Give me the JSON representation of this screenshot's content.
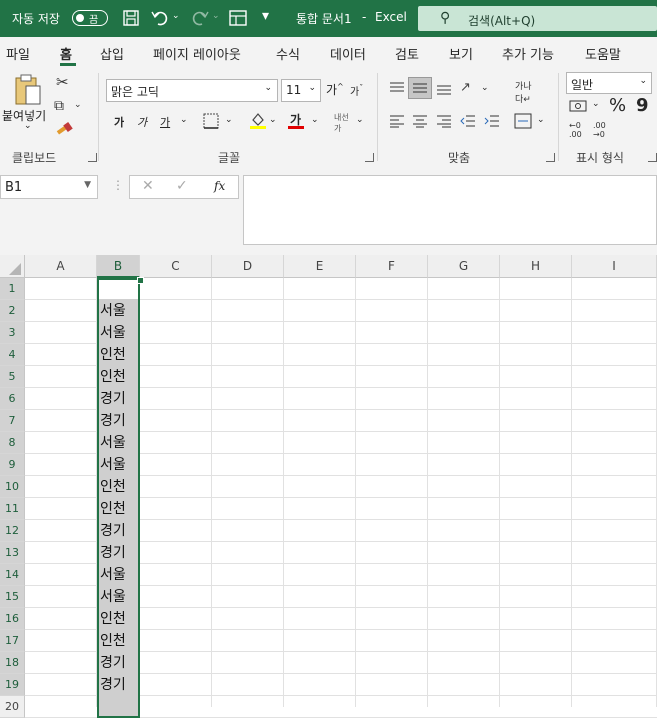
{
  "titlebar": {
    "autosave_label": "자동 저장",
    "autosave_state": "끔",
    "doc_title": "통합 문서1",
    "app_sep": "-",
    "app_name": "Excel",
    "search_placeholder": "검색(Alt+Q)",
    "accent_color": "#217346"
  },
  "tabs": [
    "파일",
    "홈",
    "삽입",
    "페이지 레이아웃",
    "수식",
    "데이터",
    "검토",
    "보기",
    "추가 기능",
    "도움말"
  ],
  "active_tab": "홈",
  "ribbon": {
    "clipboard": {
      "paste_label": "붙여넣기",
      "group_label": "클립보드"
    },
    "font": {
      "font_name": "맑은 고딕",
      "font_size": "11",
      "bold": "가",
      "italic": "가",
      "underline": "가",
      "group_label": "글꼴",
      "font_color": "#e00000",
      "fill_color": "#ffff00"
    },
    "alignment": {
      "group_label": "맞춤"
    },
    "number": {
      "format": "일반",
      "percent": "%",
      "comma": "9",
      "group_label": "표시 형식"
    }
  },
  "formula_bar": {
    "name_box": "B1",
    "fx_label": "fx",
    "formula": ""
  },
  "grid": {
    "columns": [
      "A",
      "B",
      "C",
      "D",
      "E",
      "F",
      "G",
      "H",
      "I"
    ],
    "selected_column": "B",
    "rows": [
      "1",
      "2",
      "3",
      "4",
      "5",
      "6",
      "7",
      "8",
      "9",
      "10",
      "11",
      "12",
      "13",
      "14",
      "15",
      "16",
      "17",
      "18",
      "19",
      "20"
    ],
    "column_b_values": [
      "",
      "서울",
      "서울",
      "인천",
      "인천",
      "경기",
      "경기",
      "서울",
      "서울",
      "인천",
      "인천",
      "경기",
      "경기",
      "서울",
      "서울",
      "인천",
      "인천",
      "경기",
      "경기",
      ""
    ]
  }
}
